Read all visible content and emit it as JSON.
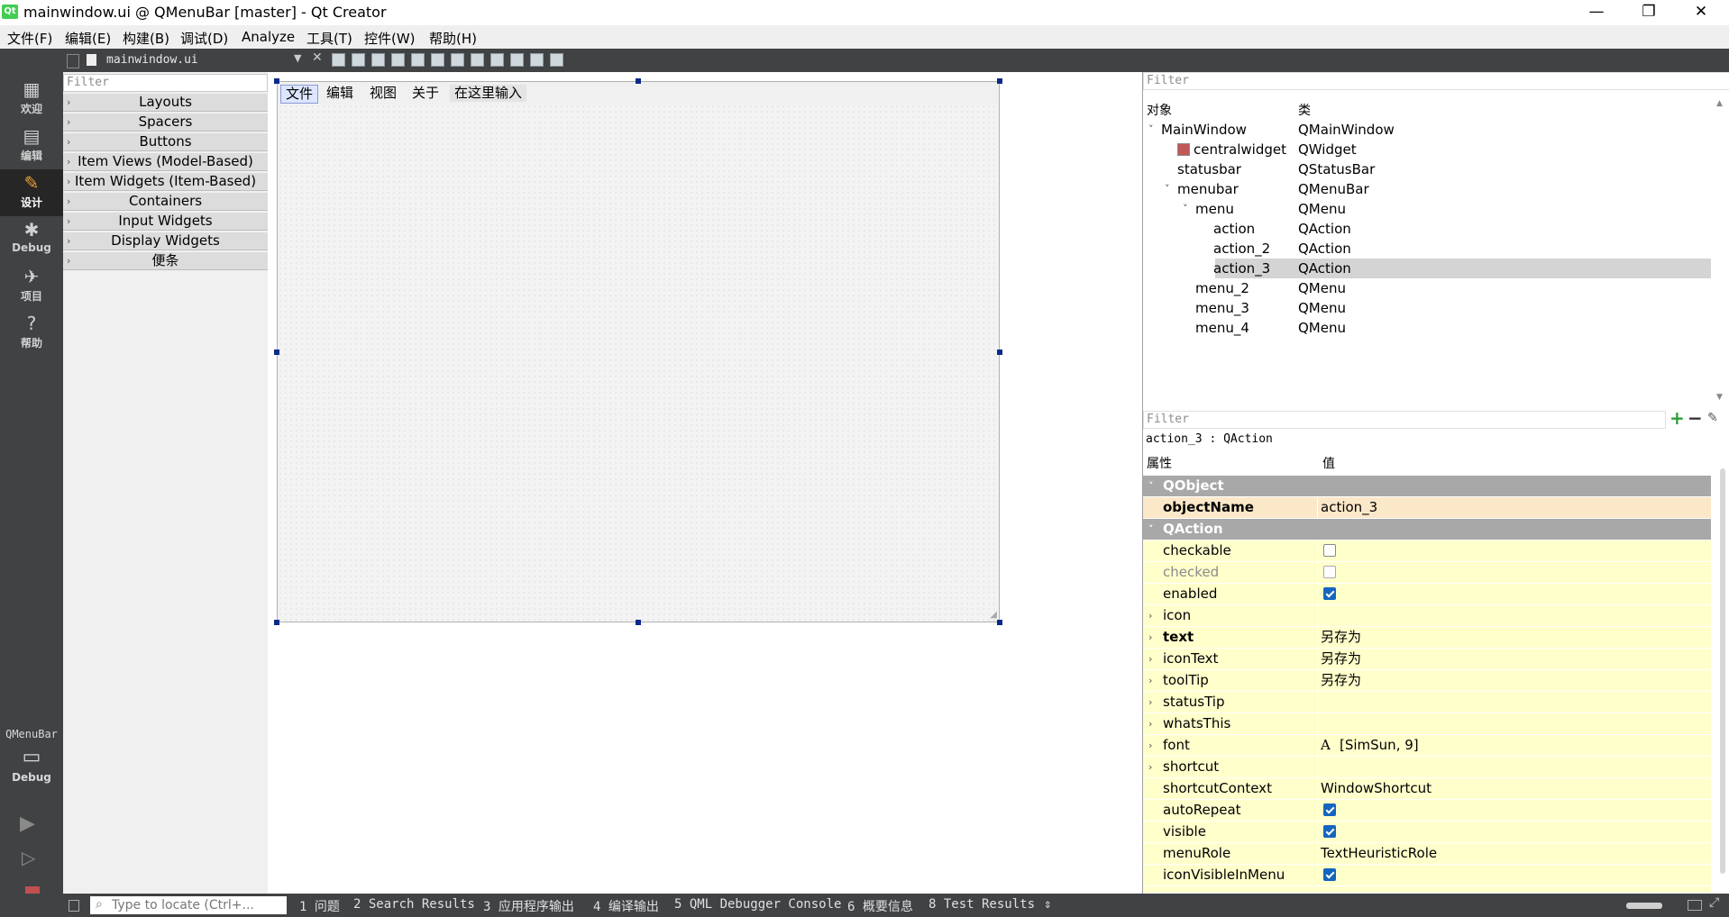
{
  "window": {
    "title": "mainwindow.ui @ QMenuBar [master] - Qt Creator",
    "app_icon": "Qt",
    "minimize": "—",
    "restore": "❐",
    "close": "✕"
  },
  "menubar": [
    "文件(F)",
    "编辑(E)",
    "构建(B)",
    "调试(D)",
    "Analyze",
    "工具(T)",
    "控件(W)",
    "帮助(H)"
  ],
  "modes": [
    {
      "label": "欢迎",
      "icon": "grid-icon",
      "glyph": "▦"
    },
    {
      "label": "编辑",
      "icon": "edit-doc-icon",
      "glyph": "▤"
    },
    {
      "label": "设计",
      "icon": "pencil-icon",
      "glyph": "✎"
    },
    {
      "label": "Debug",
      "icon": "bug-icon",
      "glyph": "✱"
    },
    {
      "label": "项目",
      "icon": "wrench-icon",
      "glyph": "✈"
    },
    {
      "label": "帮助",
      "icon": "help-icon",
      "glyph": "?"
    }
  ],
  "kit": {
    "label": "QMenuBar",
    "build": "Debug"
  },
  "toolbar": {
    "document": "mainwindow.ui"
  },
  "widgetbox": {
    "filter_placeholder": "Filter",
    "categories": [
      "Layouts",
      "Spacers",
      "Buttons",
      "Item Views (Model-Based)",
      "Item Widgets (Item-Based)",
      "Containers",
      "Input Widgets",
      "Display Widgets",
      "便条"
    ]
  },
  "form": {
    "menus": [
      "文件",
      "编辑",
      "视图",
      "关于"
    ],
    "type_here": "在这里输入"
  },
  "object_inspector": {
    "filter_placeholder": "Filter",
    "col_object": "对象",
    "col_class": "类",
    "rows": [
      {
        "name": "MainWindow",
        "cls": "QMainWindow"
      },
      {
        "name": "centralwidget",
        "cls": "QWidget"
      },
      {
        "name": "statusbar",
        "cls": "QStatusBar"
      },
      {
        "name": "menubar",
        "cls": "QMenuBar"
      },
      {
        "name": "menu",
        "cls": "QMenu"
      },
      {
        "name": "action",
        "cls": "QAction"
      },
      {
        "name": "action_2",
        "cls": "QAction"
      },
      {
        "name": "action_3",
        "cls": "QAction"
      },
      {
        "name": "menu_2",
        "cls": "QMenu"
      },
      {
        "name": "menu_3",
        "cls": "QMenu"
      },
      {
        "name": "menu_4",
        "cls": "QMenu"
      }
    ]
  },
  "property_editor": {
    "filter_placeholder": "Filter",
    "context": "action_3 : QAction",
    "col_property": "属性",
    "col_value": "值",
    "groups": [
      "QObject",
      "QAction"
    ],
    "props": [
      {
        "name": "objectName",
        "value": "action_3"
      },
      {
        "name": "checkable",
        "value": ""
      },
      {
        "name": "checked",
        "value": ""
      },
      {
        "name": "enabled",
        "value": ""
      },
      {
        "name": "icon",
        "value": ""
      },
      {
        "name": "text",
        "value": "另存为"
      },
      {
        "name": "iconText",
        "value": "另存为"
      },
      {
        "name": "toolTip",
        "value": "另存为"
      },
      {
        "name": "statusTip",
        "value": ""
      },
      {
        "name": "whatsThis",
        "value": ""
      },
      {
        "name": "font",
        "value": "[SimSun, 9]"
      },
      {
        "name": "shortcut",
        "value": ""
      },
      {
        "name": "shortcutContext",
        "value": "WindowShortcut"
      },
      {
        "name": "autoRepeat",
        "value": ""
      },
      {
        "name": "visible",
        "value": ""
      },
      {
        "name": "menuRole",
        "value": "TextHeuristicRole"
      },
      {
        "name": "iconVisibleInMenu",
        "value": ""
      }
    ],
    "checkbox_states": {
      "checkable": false,
      "checked": false,
      "enabled": true,
      "autoRepeat": true,
      "visible": true,
      "iconVisibleInMenu": true
    }
  },
  "statusbar": {
    "locate_placeholder": "Type to locate (Ctrl+...",
    "panes": [
      "1 问题",
      "2 Search Results",
      "3 应用程序输出",
      "4 编译输出",
      "5 QML Debugger Console",
      "6 概要信息",
      "8 Test Results"
    ]
  }
}
